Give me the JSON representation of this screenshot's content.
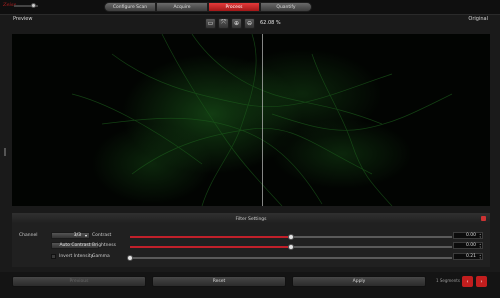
{
  "topbar": {
    "brand": "Zeiss",
    "steps": [
      "Configure Scan",
      "Acquire",
      "Process",
      "Quantify"
    ],
    "active_step_index": 2
  },
  "preview": {
    "left_label": "Preview",
    "right_label": "Original",
    "zoom_level": "62.08 %",
    "tools": [
      "fit-icon",
      "fullscreen-icon",
      "zoom-in-icon",
      "zoom-out-icon"
    ]
  },
  "filter_settings": {
    "title": "Filter Settings",
    "channel_label": "Channel",
    "channel_value": "3/3",
    "auto_contrast_label": "Auto Contrast",
    "invert_label": "Invert Intensity",
    "sliders": [
      {
        "label": "Contrast",
        "value": "0.00",
        "position": 0.5
      },
      {
        "label": "Brightness",
        "value": "0.00",
        "position": 0.5
      },
      {
        "label": "Gamma",
        "value": "0.21",
        "position": 0.0
      }
    ]
  },
  "bottom": {
    "previous_label": "Previous",
    "reset_label": "Reset",
    "apply_label": "Apply",
    "page_label": "1 Segments"
  },
  "colors": {
    "accent": "#c21e1e",
    "background": "#1a1a1a",
    "preview_bg": "#020402",
    "signal": "#1f6a1f"
  }
}
